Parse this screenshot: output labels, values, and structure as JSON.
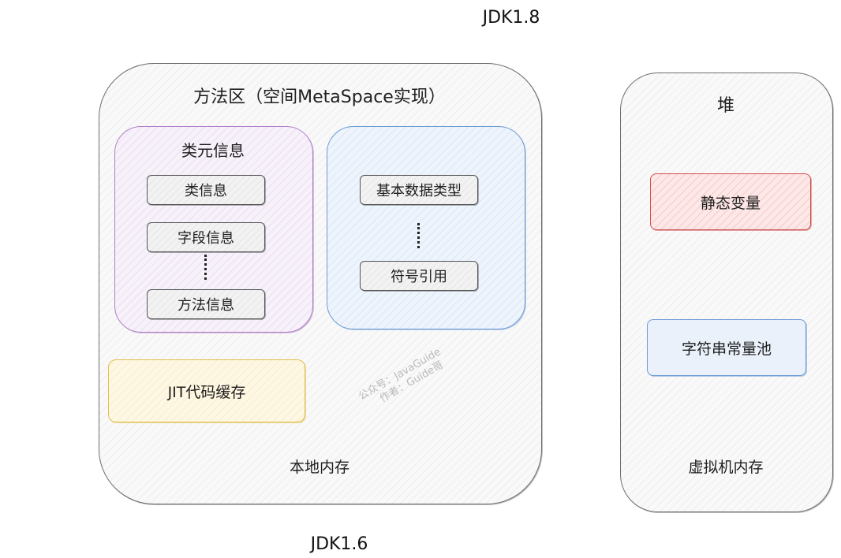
{
  "labels": {
    "jdk18": "JDK1.8",
    "jdk16": "JDK1.6"
  },
  "native_memory": {
    "method_area_title": "方法区（空间MetaSpace实现）",
    "class_meta": {
      "title": "类元信息",
      "items": [
        "类信息",
        "字段信息",
        "方法信息"
      ]
    },
    "constants": {
      "items": [
        "基本数据类型",
        "符号引用"
      ]
    },
    "jit": "JIT代码缓存",
    "label": "本地内存"
  },
  "heap": {
    "title": "堆",
    "items": [
      "静态变量",
      "字符串常量池"
    ],
    "label": "虚拟机内存"
  },
  "watermark": {
    "line1": "公众号：JavaGuide",
    "line2": "作者：Guide哥"
  },
  "colors": {
    "purple_border": "#b07fc6",
    "blue_border": "#6c9bd4",
    "yellow_border": "#e3c04e",
    "red_border": "#cf4e4e",
    "outline": "#6d6d6d"
  }
}
